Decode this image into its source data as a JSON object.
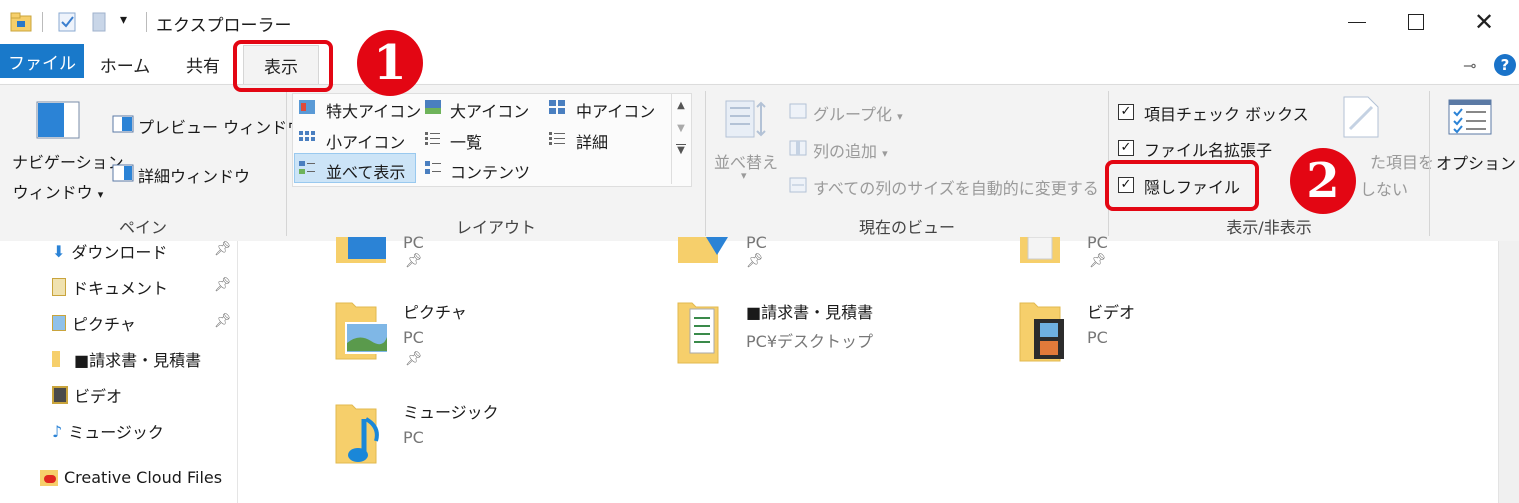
{
  "window": {
    "title": "エクスプローラー"
  },
  "tabs": [
    "ファイル",
    "ホーム",
    "共有",
    "表示"
  ],
  "ribbon": {
    "pane": {
      "nav_label_1": "ナビゲーション",
      "nav_label_2": "ウィンドウ",
      "preview": "プレビュー ウィンドウ",
      "details": "詳細ウィンドウ",
      "label": "ペイン"
    },
    "layout": {
      "items": [
        "特大アイコン",
        "大アイコン",
        "中アイコン",
        "小アイコン",
        "一覧",
        "詳細",
        "並べて表示",
        "コンテンツ"
      ],
      "selected": "並べて表示",
      "label": "レイアウト"
    },
    "current_view": {
      "sort": "並べ替え",
      "group": "グループ化",
      "add_column": "列の追加",
      "fit_columns": "すべての列のサイズを自動的に変更する",
      "label": "現在のビュー"
    },
    "show_hide": {
      "item_checkbox": "項目チェック ボックス",
      "extensions": "ファイル名拡張子",
      "hidden_files": "隠しファイル",
      "hide_selected_1": "た項目を",
      "hide_selected_2": "しない",
      "label": "表示/非表示"
    },
    "options": {
      "label": "オプション"
    }
  },
  "nav": [
    {
      "label": "ダウンロード",
      "pinned": true
    },
    {
      "label": "ドキュメント",
      "pinned": true
    },
    {
      "label": "ピクチャ",
      "pinned": true
    },
    {
      "label": "■請求書・見積書",
      "pinned": false
    },
    {
      "label": "ビデオ",
      "pinned": false
    },
    {
      "label": "ミュージック",
      "pinned": false
    },
    {
      "label": "Creative Cloud Files",
      "pinned": false
    }
  ],
  "content": {
    "top_partial_sub": "PC",
    "tiles": [
      {
        "name": "ピクチャ",
        "sub": "PC"
      },
      {
        "name": "■請求書・見積書",
        "sub": "PC¥デスクトップ"
      },
      {
        "name": "ビデオ",
        "sub": "PC"
      },
      {
        "name": "ミュージック",
        "sub": "PC"
      }
    ]
  },
  "annotations": {
    "badge1": "1",
    "badge2": "2"
  },
  "colors": {
    "file_tab": "#1979ca",
    "highlight": "#e30613",
    "folder": "#f6cf6b"
  }
}
